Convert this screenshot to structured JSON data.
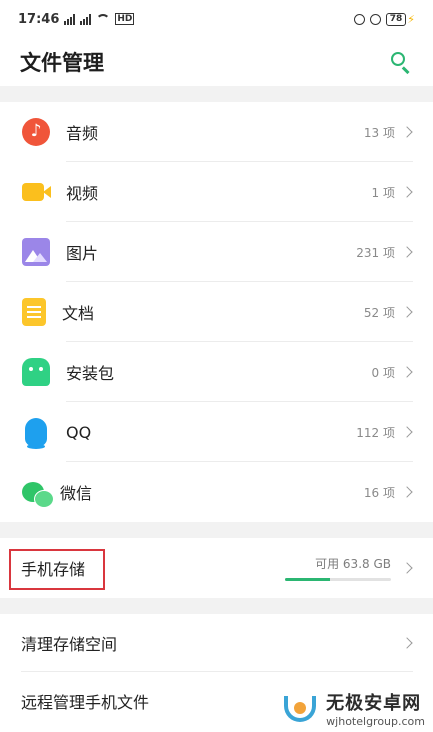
{
  "status": {
    "time": "17:46",
    "network": "HD",
    "battery": "78"
  },
  "header": {
    "title": "文件管理"
  },
  "categories": [
    {
      "label": "音频",
      "count": "13 项"
    },
    {
      "label": "视频",
      "count": "1 项"
    },
    {
      "label": "图片",
      "count": "231 项"
    },
    {
      "label": "文档",
      "count": "52 项"
    },
    {
      "label": "安装包",
      "count": "0 项"
    },
    {
      "label": "QQ",
      "count": "112 项"
    },
    {
      "label": "微信",
      "count": "16 项"
    }
  ],
  "storage": {
    "label": "手机存储",
    "available": "可用 63.8 GB",
    "used_fraction": 0.42
  },
  "tools": [
    {
      "label": "清理存储空间"
    },
    {
      "label": "远程管理手机文件"
    }
  ],
  "watermark": {
    "title": "无极安卓网",
    "url": "wjhotelgroup.com"
  },
  "colors": {
    "accent": "#2bb672",
    "highlight": "#d9363e"
  }
}
